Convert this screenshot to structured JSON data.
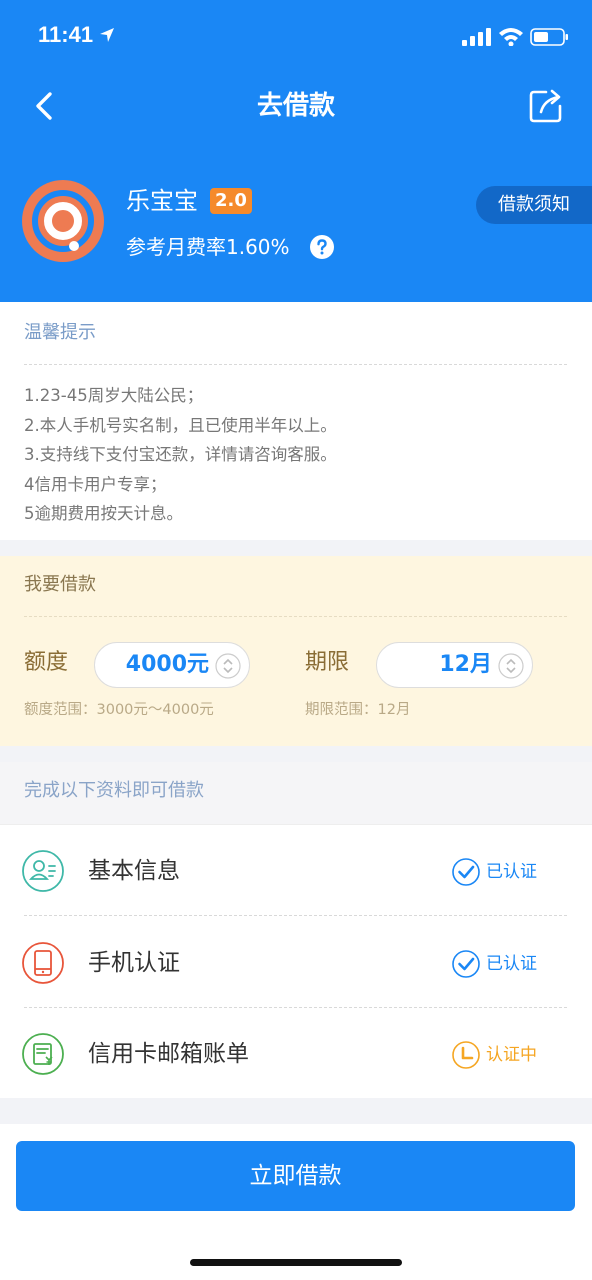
{
  "status_bar": {
    "time": "11:41"
  },
  "nav": {
    "title": "去借款"
  },
  "product": {
    "name": "乐宝宝",
    "version": "2.0",
    "rate": "参考月费率1.60%",
    "notice_label": "借款须知"
  },
  "tips": {
    "title": "温馨提示",
    "items": [
      "1.23-45周岁大陆公民；",
      "2.本人手机号实名制，且已使用半年以上。",
      "3.支持线下支付宝还款，详情请咨询客服。",
      "4信用卡用户专享；",
      "5逾期费用按天计息。"
    ]
  },
  "borrow": {
    "title": "我要借款",
    "amount_label": "额度",
    "amount_value": "4000元",
    "amount_range": "额度范围：3000元～4000元",
    "term_label": "期限",
    "term_value": "12月",
    "term_range": "期限范围：12月"
  },
  "requirements": {
    "header": "完成以下资料即可借款",
    "items": [
      {
        "label": "基本信息",
        "status": "已认证",
        "icon": "user-card-icon",
        "status_icon": "check-circle-icon",
        "status_color": "#1a87f5"
      },
      {
        "label": "手机认证",
        "status": "已认证",
        "icon": "phone-icon",
        "status_icon": "check-circle-icon",
        "status_color": "#1a87f5"
      },
      {
        "label": "信用卡邮箱账单",
        "status": "认证中",
        "icon": "bill-icon",
        "status_icon": "clock-icon",
        "status_color": "#f5a623"
      }
    ]
  },
  "cta": {
    "label": "立即借款"
  },
  "colors": {
    "primary": "#1a87f5",
    "accent": "#f58a2b",
    "pending": "#f5a623"
  }
}
